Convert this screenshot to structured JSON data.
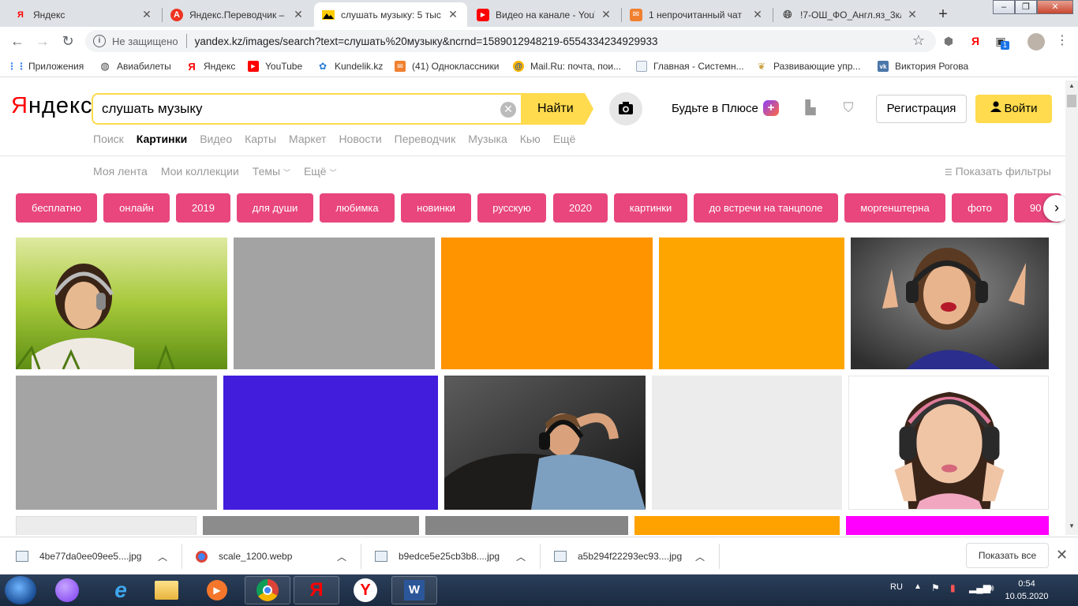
{
  "browser": {
    "tabs": [
      {
        "label": "Яндекс",
        "icon": "yandex-icon",
        "active": false
      },
      {
        "label": "Яндекс.Переводчик – с",
        "icon": "translate-icon",
        "active": false
      },
      {
        "label": "слушать музыку: 5 тыс",
        "icon": "images-icon",
        "active": true
      },
      {
        "label": "Видео на канале - YouT",
        "icon": "youtube-icon",
        "active": false
      },
      {
        "label": "1 непрочитанный чат",
        "icon": "mail-icon",
        "active": false
      },
      {
        "label": "!7-ОШ_ФО_Англ.яз_3кл",
        "icon": "globe-icon",
        "active": false
      }
    ],
    "tab_close": "✕",
    "new_tab": "+",
    "window_controls": [
      "–",
      "❐",
      "✕"
    ],
    "security_label": "Не защищено",
    "url": "yandex.kz/images/search?text=слушать%20музыку&ncrnd=1589012948219-6554334234929933",
    "extension_badge": "1",
    "bookmarks": [
      {
        "label": "Приложения",
        "icon": "apps-icon"
      },
      {
        "label": "Авиабилеты",
        "icon": "globe-icon"
      },
      {
        "label": "Яндекс",
        "icon": "yandex-icon"
      },
      {
        "label": "YouTube",
        "icon": "youtube-icon"
      },
      {
        "label": "Kundelik.kz",
        "icon": "kundelik-icon"
      },
      {
        "label": "(41) Одноклассники",
        "icon": "ok-icon"
      },
      {
        "label": "Mail.Ru: почта, пои...",
        "icon": "mailru-icon"
      },
      {
        "label": "Главная - Системн...",
        "icon": "doc-icon"
      },
      {
        "label": "Развивающие упр...",
        "icon": "bird-icon"
      },
      {
        "label": "Виктория Рогова",
        "icon": "vk-icon"
      }
    ]
  },
  "header": {
    "logo_first": "Я",
    "logo_rest": "ндекс",
    "search_value": "слушать музыку",
    "search_button": "Найти",
    "plus_label": "Будьте в Плюсе",
    "register_button": "Регистрация",
    "login_button": "Войти"
  },
  "services": [
    "Поиск",
    "Картинки",
    "Видео",
    "Карты",
    "Маркет",
    "Новости",
    "Переводчик",
    "Музыка",
    "Кью",
    "Ещё"
  ],
  "active_service": "Картинки",
  "subnav": {
    "items": [
      "Моя лента",
      "Мои коллекции",
      "Темы",
      "Ещё"
    ],
    "filters_label": "Показать фильтры"
  },
  "chips": [
    "бесплатно",
    "онлайн",
    "2019",
    "для души",
    "любимка",
    "новинки",
    "русскую",
    "2020",
    "картинки",
    "до встречи на танцполе",
    "моргенштерна",
    "фото",
    "90"
  ],
  "images": {
    "row1": [
      "photo",
      "#a3a3a3",
      "#ff9400",
      "#ffa500",
      "photo"
    ],
    "row2": [
      "#a4a4a4",
      "#421ddc",
      "photo",
      "#ececec",
      "photo"
    ],
    "row3": [
      "#ececec",
      "#8c8c8c",
      "#858585",
      "#ffa200",
      "#ff00ff"
    ]
  },
  "downloads": {
    "items": [
      "4be77da0ee09ee5....jpg",
      "scale_1200.webp",
      "b9edce5e25cb3b8....jpg",
      "a5b294f22293ec93....jpg"
    ],
    "show_all": "Показать все"
  },
  "taskbar": {
    "language": "RU",
    "time": "0:54",
    "date": "10.05.2020"
  },
  "colors": {
    "accent_yellow": "#ffdb4d",
    "chip_pink": "#e8467c",
    "logo_red": "#ff0000"
  }
}
